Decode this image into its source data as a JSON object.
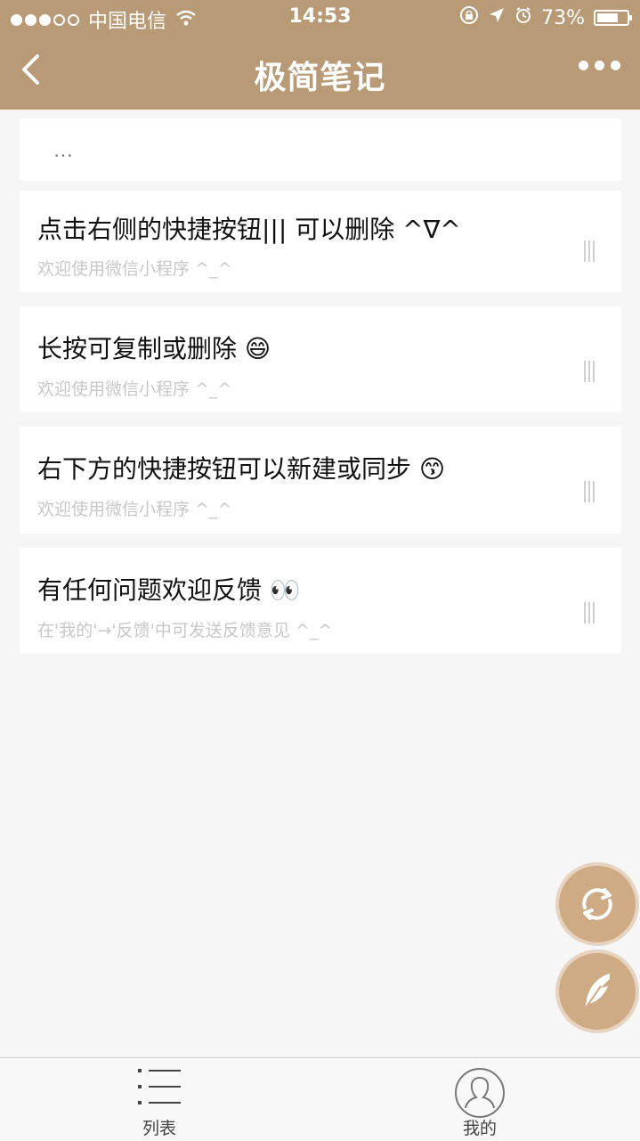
{
  "status_bar": {
    "carrier": "中国电信",
    "time": "14:53",
    "battery": "73%",
    "battery_level": 0.73
  },
  "nav": {
    "title": "极简笔记"
  },
  "placeholder": {
    "text": "…"
  },
  "notes": [
    {
      "title": "点击右侧的快捷按钮||| 可以删除 ^∇^",
      "subtitle": "欢迎使用微信小程序 ^_^"
    },
    {
      "title": "长按可复制或删除 😄",
      "subtitle": "欢迎使用微信小程序 ^_^"
    },
    {
      "title": "右下方的快捷按钮可以新建或同步 😙",
      "subtitle": "欢迎使用微信小程序 ^_^"
    },
    {
      "title": "有任何问题欢迎反馈 👀",
      "subtitle": "在'我的'→'反馈'中可发送反馈意见 ^_^"
    }
  ],
  "fab": {
    "sync_icon": "sync-icon",
    "new_icon": "feather-icon"
  },
  "tabbar": {
    "tabs": [
      {
        "label": "列表",
        "icon": "list-icon"
      },
      {
        "label": "我的",
        "icon": "user-icon"
      }
    ]
  },
  "colors": {
    "header": "#b99a76",
    "accent": "#ceaa85"
  }
}
